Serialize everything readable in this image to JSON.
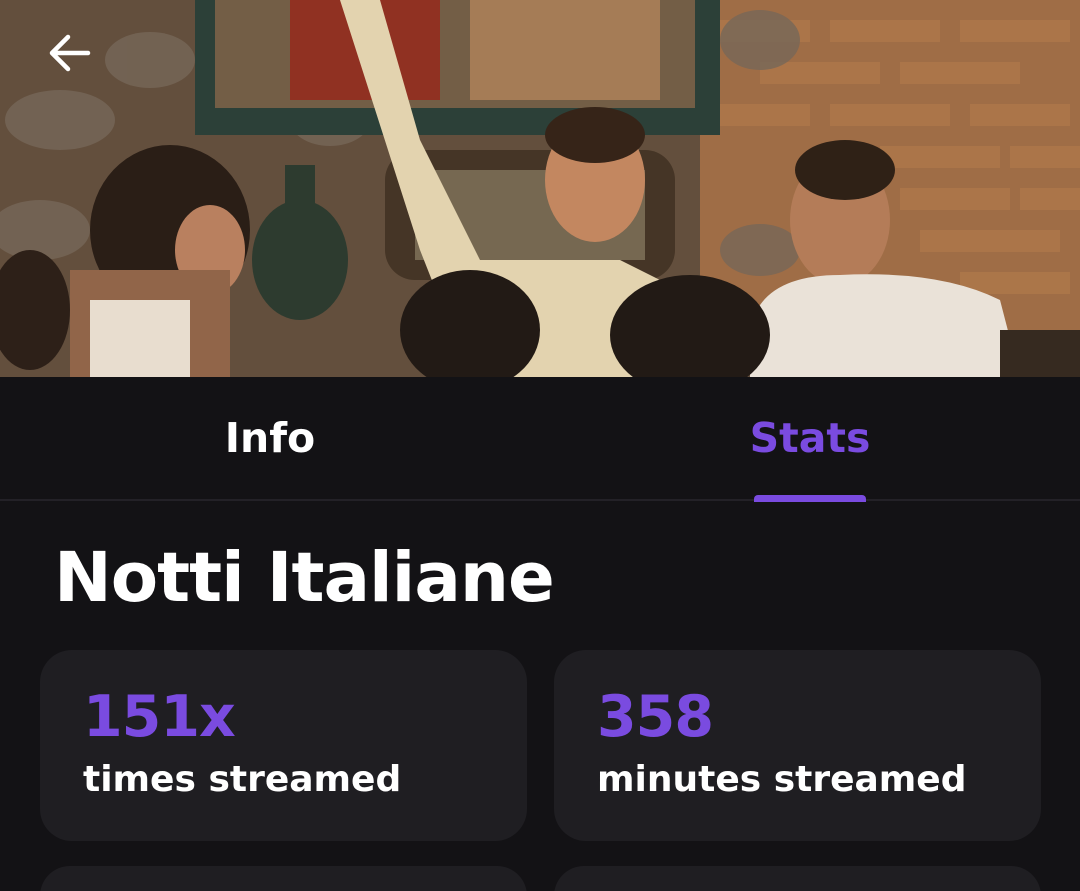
{
  "header": {
    "back_icon": "arrow-left-icon"
  },
  "tabs": [
    {
      "label": "Info",
      "active": false
    },
    {
      "label": "Stats",
      "active": true
    }
  ],
  "colors": {
    "accent": "#7a4be0",
    "background": "#131215",
    "card": "#1f1e22",
    "text": "#ffffff"
  },
  "stats": {
    "title": "Notti Italiane",
    "cards": [
      {
        "value": "151x",
        "label": "times streamed"
      },
      {
        "value": "358",
        "label": "minutes streamed"
      }
    ]
  }
}
